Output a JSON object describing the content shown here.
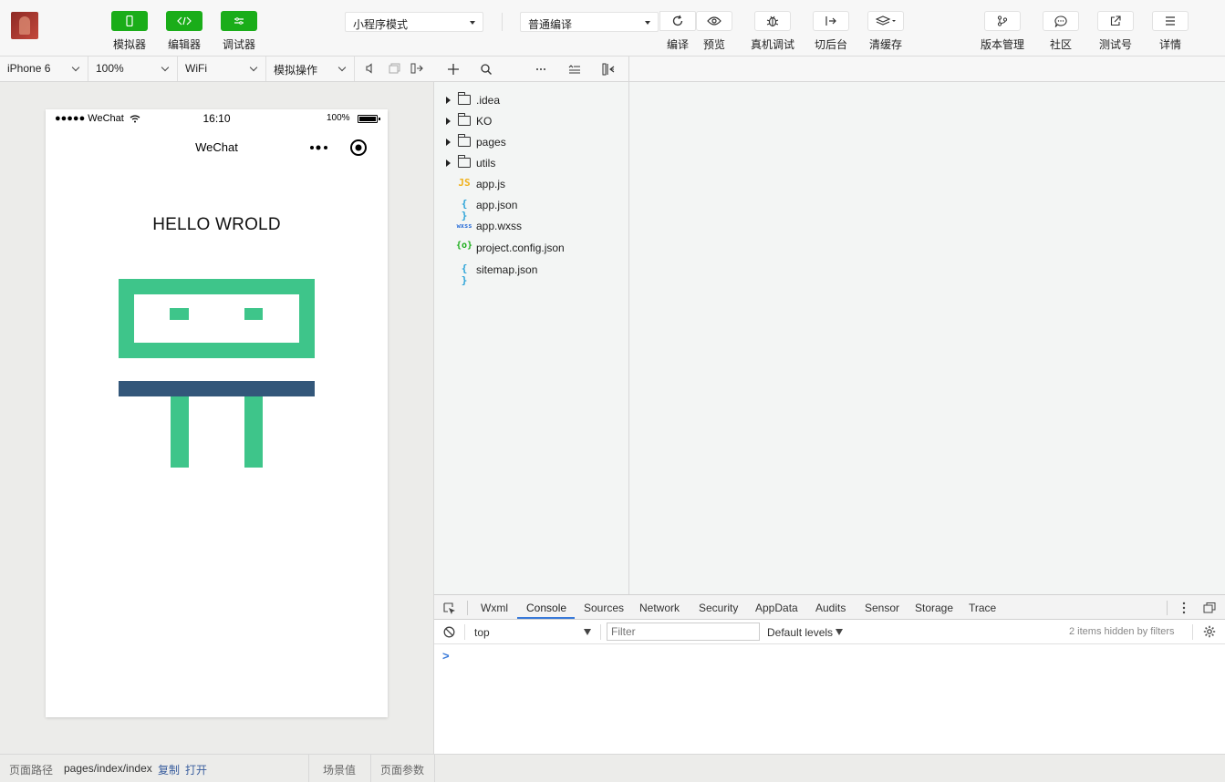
{
  "toolbar": {
    "left_buttons": [
      {
        "label": "模拟器"
      },
      {
        "label": "编辑器"
      },
      {
        "label": "调试器"
      }
    ],
    "mode_select": "小程序模式",
    "compile_select": "普通编译",
    "actions": [
      {
        "label": "编译",
        "icon": "refresh-icon"
      },
      {
        "label": "预览",
        "icon": "eye-icon"
      },
      {
        "label": "真机调试",
        "icon": "bug-icon"
      },
      {
        "label": "切后台",
        "icon": "switch-icon"
      },
      {
        "label": "清缓存",
        "icon": "layers-icon"
      }
    ],
    "right_actions": [
      {
        "label": "版本管理",
        "icon": "branch-icon"
      },
      {
        "label": "社区",
        "icon": "chat-icon"
      },
      {
        "label": "测试号",
        "icon": "external-link-icon"
      },
      {
        "label": "详情",
        "icon": "menu-icon"
      }
    ]
  },
  "simulator_bar": {
    "device": "iPhone 6",
    "zoom": "100%",
    "network": "WiFi",
    "operation": "模拟操作"
  },
  "phone": {
    "carrier": "●●●●● WeChat",
    "time": "16:10",
    "battery": "100%",
    "nav_title": "WeChat",
    "hello_text": "HELLO WROLD",
    "colors": {
      "green": "#3ec58a",
      "navy": "#33577a"
    }
  },
  "file_tree": [
    {
      "name": ".idea",
      "type": "folder"
    },
    {
      "name": "KO",
      "type": "folder"
    },
    {
      "name": "pages",
      "type": "folder"
    },
    {
      "name": "utils",
      "type": "folder"
    },
    {
      "name": "app.js",
      "type": "js",
      "icon_text": "JS"
    },
    {
      "name": "app.json",
      "type": "json",
      "icon_text": "{ }"
    },
    {
      "name": "app.wxss",
      "type": "wxss",
      "icon_text": "wxss"
    },
    {
      "name": "project.config.json",
      "type": "config",
      "icon_text": "{o}"
    },
    {
      "name": "sitemap.json",
      "type": "json",
      "icon_text": "{ }"
    }
  ],
  "devtools": {
    "tabs": [
      "Wxml",
      "Console",
      "Sources",
      "Network",
      "Security",
      "AppData",
      "Audits",
      "Sensor",
      "Storage",
      "Trace"
    ],
    "active_tab": "Console",
    "context": "top",
    "filter_placeholder": "Filter",
    "levels": "Default levels",
    "hidden_msg": "2 items hidden by filters",
    "prompt": ">"
  },
  "statusbar": {
    "path_label": "页面路径",
    "path_value": "pages/index/index",
    "copy": "复制",
    "open": "打开",
    "scene": "场景值",
    "params": "页面参数"
  }
}
